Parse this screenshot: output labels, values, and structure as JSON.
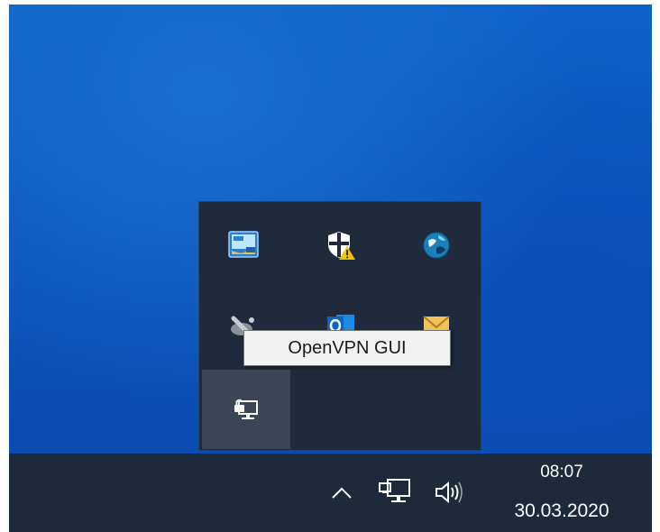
{
  "desktop": {
    "background_color": "#0b5cc4"
  },
  "overflow_panel": {
    "background_color": "#1f2b3d",
    "icons": [
      {
        "name": "intel-graphics-icon"
      },
      {
        "name": "windows-security-warning-icon"
      },
      {
        "name": "globe-app-icon"
      },
      {
        "name": "satellite-app-icon"
      },
      {
        "name": "outlook-icon"
      },
      {
        "name": "mail-envelope-icon"
      },
      {
        "name": "openvpn-gui-icon"
      }
    ]
  },
  "tooltip": {
    "text": "OpenVPN GUI"
  },
  "taskbar": {
    "background_color": "#1d2a3c",
    "clock": {
      "time": "08:07",
      "date": "30.03.2020"
    }
  }
}
